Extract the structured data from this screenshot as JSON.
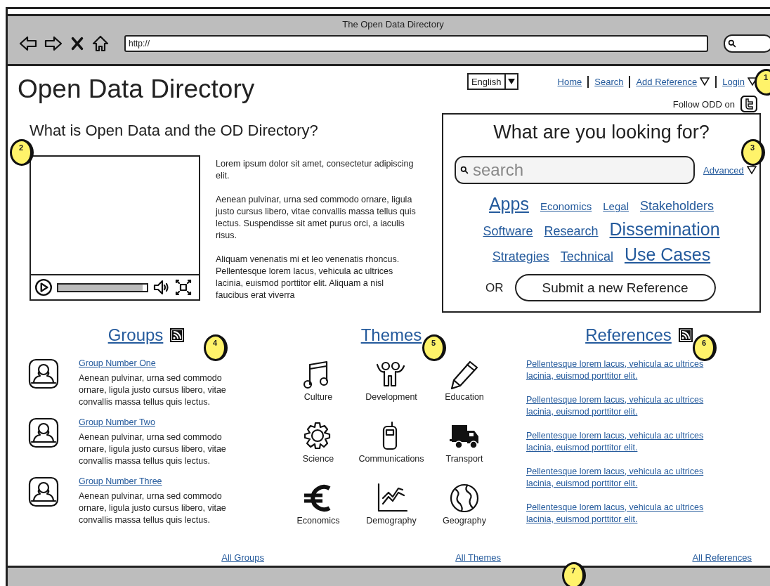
{
  "browser": {
    "title": "The Open Data Directory",
    "url": "http://"
  },
  "header": {
    "logo": "Open Data Directory",
    "language": "English",
    "nav": [
      {
        "label": "Home",
        "dropdown": false
      },
      {
        "label": "Search",
        "dropdown": false
      },
      {
        "label": "Add Reference",
        "dropdown": true
      },
      {
        "label": "Login",
        "dropdown": true
      }
    ],
    "follow": "Follow ODD on"
  },
  "intro": {
    "title": "What is Open Data and the OD Directory?",
    "video": {
      "level": 0.95
    },
    "paragraphs": [
      "Lorem ipsum dolor sit amet, consectetur adipiscing elit.",
      "Aenean pulvinar, urna sed commodo ornare, ligula justo cursus libero, vitae convallis massa tellus quis lectus. Suspendisse sit amet purus orci, a iaculis risus.",
      "Aliquam venenatis mi et leo venenatis rhoncus. Pellentesque lorem lacus, vehicula ac ultrices lacinia, euismod porttitor elit. Aliquam a nisl faucibus erat viverra"
    ]
  },
  "search_panel": {
    "title": "What are you looking for?",
    "placeholder": "search",
    "advanced": "Advanced",
    "tag_rows": [
      [
        {
          "label": "Apps",
          "kind": "large"
        },
        {
          "label": "Economics",
          "kind": "small"
        },
        {
          "label": "Legal",
          "kind": "small"
        },
        {
          "label": "Stakeholders",
          "kind": "medium"
        }
      ],
      [
        {
          "label": "Software",
          "kind": "medium"
        },
        {
          "label": "Research",
          "kind": "medium"
        },
        {
          "label": "Dissemination",
          "kind": "large"
        }
      ],
      [
        {
          "label": "Strategies",
          "kind": "medium"
        },
        {
          "label": "Technical",
          "kind": "medium"
        },
        {
          "label": "Use Cases",
          "kind": "large"
        }
      ]
    ],
    "or": "OR",
    "submit": "Submit a new Reference"
  },
  "groups": {
    "title": "Groups",
    "rss": true,
    "items": [
      {
        "name": "Group Number One",
        "text": "Aenean pulvinar, urna sed commodo ornare, ligula justo cursus libero, vitae convallis massa tellus quis lectus."
      },
      {
        "name": "Group Number Two",
        "text": "Aenean pulvinar, urna sed commodo ornare, ligula justo cursus libero, vitae convallis massa tellus quis lectus."
      },
      {
        "name": "Group Number Three",
        "text": "Aenean pulvinar, urna sed commodo ornare, ligula justo cursus libero, vitae convallis massa tellus quis lectus."
      }
    ],
    "all": "All Groups"
  },
  "themes": {
    "title": "Themes",
    "items": [
      {
        "label": "Culture"
      },
      {
        "label": "Development"
      },
      {
        "label": "Education"
      },
      {
        "label": "Science"
      },
      {
        "label": "Communications"
      },
      {
        "label": "Transport"
      },
      {
        "label": "Economics"
      },
      {
        "label": "Demography"
      },
      {
        "label": "Geography"
      }
    ],
    "all": "All Themes"
  },
  "references": {
    "title": "References",
    "rss": true,
    "items": [
      "Pellentesque lorem lacus, vehicula ac ultrices lacinia, euismod porttitor elit.",
      "Pellentesque lorem lacus, vehicula ac ultrices lacinia, euismod porttitor elit.",
      "Pellentesque lorem lacus, vehicula ac ultrices lacinia, euismod porttitor elit.",
      "Pellentesque lorem lacus, vehicula ac ultrices lacinia, euismod porttitor elit.",
      "Pellentesque lorem lacus, vehicula ac ultrices lacinia, euismod porttitor elit."
    ],
    "all": "All References"
  },
  "callouts": [
    "1",
    "2",
    "3",
    "4",
    "5",
    "6",
    "7"
  ]
}
